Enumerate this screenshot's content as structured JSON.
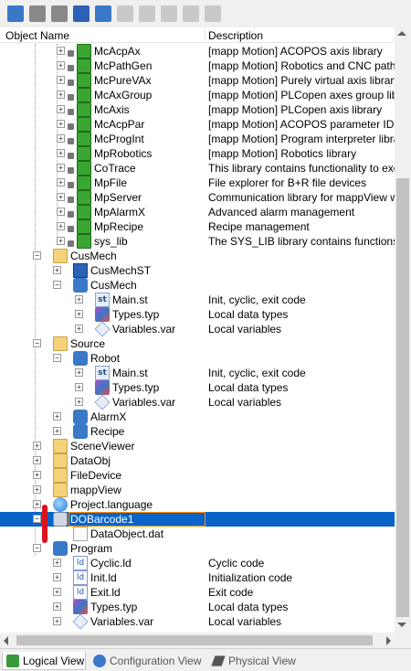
{
  "columns": {
    "name": "Object Name",
    "description": "Description"
  },
  "toolbar": {
    "buttons": [
      {
        "icon": "new-object-icon",
        "disabled": false
      },
      {
        "icon": "properties-icon",
        "disabled": false
      },
      {
        "icon": "table-icon",
        "disabled": false
      },
      {
        "icon": "help-icon",
        "disabled": false
      },
      {
        "icon": "add-object-icon",
        "disabled": false
      },
      {
        "icon": "move-up-icon",
        "disabled": true
      },
      {
        "icon": "edit-icon",
        "disabled": true
      },
      {
        "icon": "link-icon",
        "disabled": true
      },
      {
        "icon": "copy-icon",
        "disabled": true
      },
      {
        "icon": "settings-icon",
        "disabled": true
      }
    ]
  },
  "tree": {
    "rows": [
      {
        "name": "McAcpAx",
        "desc": "[mapp Motion] ACOPOS axis library",
        "icon": "library-icon",
        "locked": true
      },
      {
        "name": "McPathGen",
        "desc": "[mapp Motion] Robotics and CNC path gen",
        "icon": "library-icon",
        "locked": true
      },
      {
        "name": "McPureVAx",
        "desc": "[mapp Motion] Purely virtual axis library",
        "icon": "library-icon",
        "locked": true
      },
      {
        "name": "McAxGroup",
        "desc": "[mapp Motion] PLCopen axes group library",
        "icon": "library-icon",
        "locked": true
      },
      {
        "name": "McAxis",
        "desc": "[mapp Motion] PLCopen axis library",
        "icon": "library-icon",
        "locked": true
      },
      {
        "name": "McAcpPar",
        "desc": "[mapp Motion] ACOPOS parameter ID librar",
        "icon": "library-icon",
        "locked": true
      },
      {
        "name": "McProgInt",
        "desc": "[mapp Motion] Program interpreter library",
        "icon": "library-icon",
        "locked": true
      },
      {
        "name": "MpRobotics",
        "desc": "[mapp Motion] Robotics library",
        "icon": "library-icon",
        "locked": true
      },
      {
        "name": "CoTrace",
        "desc": "This library contains functionality to execute",
        "icon": "library-icon",
        "locked": true
      },
      {
        "name": "MpFile",
        "desc": "File explorer for B+R file devices",
        "icon": "library-icon",
        "locked": true
      },
      {
        "name": "MpServer",
        "desc": "Communication library for mappView widget",
        "icon": "library-icon",
        "locked": true
      },
      {
        "name": "MpAlarmX",
        "desc": "Advanced alarm management",
        "icon": "library-icon",
        "locked": true
      },
      {
        "name": "MpRecipe",
        "desc": "Recipe management",
        "icon": "library-icon",
        "locked": true
      },
      {
        "name": "sys_lib",
        "desc": "The SYS_LIB library contains functions for",
        "icon": "library-icon",
        "locked": true
      },
      {
        "name": "CusMech",
        "desc": "",
        "icon": "folder-icon",
        "locked": false
      },
      {
        "name": "CusMechST",
        "desc": "",
        "icon": "object-icon",
        "locked": false
      },
      {
        "name": "CusMech",
        "desc": "",
        "icon": "program-icon",
        "locked": false
      },
      {
        "name": "Main.st",
        "desc": "Init, cyclic, exit code",
        "icon": "st-file-icon",
        "locked": false
      },
      {
        "name": "Types.typ",
        "desc": "Local data types",
        "icon": "types-file-icon",
        "locked": false
      },
      {
        "name": "Variables.var",
        "desc": "Local variables",
        "icon": "variables-file-icon",
        "locked": false
      },
      {
        "name": "Source",
        "desc": "",
        "icon": "folder-icon",
        "locked": false
      },
      {
        "name": "Robot",
        "desc": "",
        "icon": "program-icon",
        "locked": false
      },
      {
        "name": "Main.st",
        "desc": "Init, cyclic, exit code",
        "icon": "st-file-icon",
        "locked": false
      },
      {
        "name": "Types.typ",
        "desc": "Local data types",
        "icon": "types-file-icon",
        "locked": false
      },
      {
        "name": "Variables.var",
        "desc": "Local variables",
        "icon": "variables-file-icon",
        "locked": false
      },
      {
        "name": "AlarmX",
        "desc": "",
        "icon": "program-icon",
        "locked": false
      },
      {
        "name": "Recipe",
        "desc": "",
        "icon": "program-icon",
        "locked": false
      },
      {
        "name": "SceneViewer",
        "desc": "",
        "icon": "folder-icon",
        "locked": false
      },
      {
        "name": "DataObj",
        "desc": "",
        "icon": "folder-icon",
        "locked": false
      },
      {
        "name": "FileDevice",
        "desc": "",
        "icon": "folder-icon",
        "locked": false
      },
      {
        "name": "mappView",
        "desc": "",
        "icon": "folder-icon",
        "locked": false
      },
      {
        "name": "Project.language",
        "desc": "",
        "icon": "globe-icon",
        "locked": false
      },
      {
        "name": "DOBarcode1",
        "desc": "",
        "icon": "data-object-icon",
        "locked": false,
        "selected": true
      },
      {
        "name": "DataObject.dat",
        "desc": "",
        "icon": "dat-file-icon",
        "locked": false
      },
      {
        "name": "Program",
        "desc": "",
        "icon": "program-icon",
        "locked": false
      },
      {
        "name": "Cyclic.ld",
        "desc": "Cyclic code",
        "icon": "ld-file-icon",
        "locked": false
      },
      {
        "name": "Init.ld",
        "desc": "Initialization code",
        "icon": "ld-file-icon",
        "locked": false
      },
      {
        "name": "Exit.ld",
        "desc": "Exit code",
        "icon": "ld-file-icon",
        "locked": false
      },
      {
        "name": "Types.typ",
        "desc": "Local data types",
        "icon": "types-file-icon",
        "locked": false
      },
      {
        "name": "Variables.var",
        "desc": "Local variables",
        "icon": "variables-file-icon",
        "locked": false
      }
    ]
  },
  "tabs": [
    {
      "label": "Logical View",
      "icon": "logical-view-icon",
      "active": true
    },
    {
      "label": "Configuration View",
      "icon": "configuration-view-icon",
      "active": false
    },
    {
      "label": "Physical View",
      "icon": "physical-view-icon",
      "active": false
    }
  ],
  "colors": {
    "selection": "#0a64c8",
    "selection_outline": "#ff8a00",
    "annotation_mark": "#d8141e"
  }
}
